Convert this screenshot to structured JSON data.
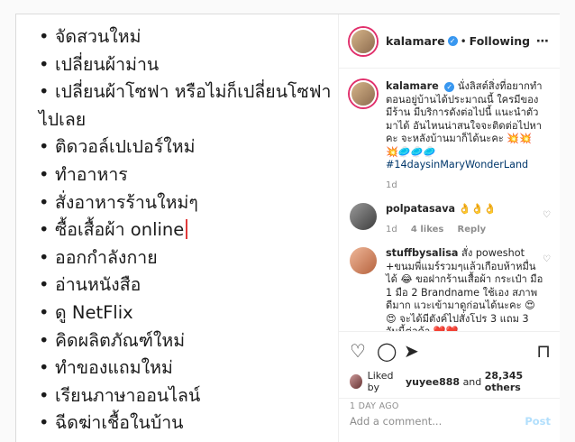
{
  "photo": {
    "items": [
      "จัดสวนใหม่",
      "เปลี่ยนผ้าม่าน",
      "เปลี่ยนผ้าโซฟา หรือไม่ก็เปลี่ยนโซฟาไปเลย",
      "ติดวอล์เปเปอร์ใหม่",
      "ทำอาหาร",
      "สั่งอาหารร้านใหม่ๆ",
      "ซื้อเสื้อผ้า online",
      "ออกกำลังกาย",
      "อ่านหนังสือ",
      "ดู NetFlix",
      "คิดผลิตภัณฑ์ใหม่",
      "ทำของแถมใหม่",
      "เรียนภาษาออนไลน์",
      "ฉีดฆ่าเชื้อในบ้าน"
    ],
    "bullet": "•"
  },
  "header": {
    "username": "kalamare",
    "separator": "•",
    "follow_status": "Following",
    "more_icon": "⋯"
  },
  "caption": {
    "username": "kalamare",
    "text": "นั่งลิสต์สิ่งที่อยากทำตอนอยู่บ้านได้ประมาณนี้ ใครมีของ มีร้าน มีบริการดังต่อไปนี้ แนะนำตัวมาได้ อันไหนน่าสนใจจะติดต่อไปหาคะ จะหลังบ้านมาก็ได้นะคะ 💥💥💥🥏🥏🥏",
    "hashtag": "#14daysinMaryWonderLand",
    "time": "1d"
  },
  "comments": [
    {
      "username": "polpatasava",
      "text": "👌👌👌",
      "time": "1d",
      "likes": "4 likes",
      "reply": "Reply"
    },
    {
      "username": "stuffbysalisa",
      "text": "สั่ง poweshot +ขนมพี่แมร์รวมๆแล้วเกือบห้าหมื่นได้ 😂 ขอฝากร้านเสื้อผ้า กระเป๋า มือ 1 มือ 2 Brandname ใช้เอง สภาพดีมาก แวะเข้ามาดูก่อนได้นะคะ 😍😍 จะได้มีตังค์ไปสั่งโปร 3 แถม 3 วันนี้ต่อค้า ❤️❤️"
    }
  ],
  "actions": {
    "like_icon": "♡",
    "comment_icon": "◯",
    "share_icon": "➤",
    "save_icon": "⊓",
    "likes_prefix": "Liked by",
    "likes_user": "yuyee888",
    "likes_mid": "and",
    "likes_count": "28,345 others",
    "timestamp": "1 DAY AGO"
  },
  "add_comment": {
    "placeholder": "Add a comment...",
    "post_label": "Post"
  }
}
